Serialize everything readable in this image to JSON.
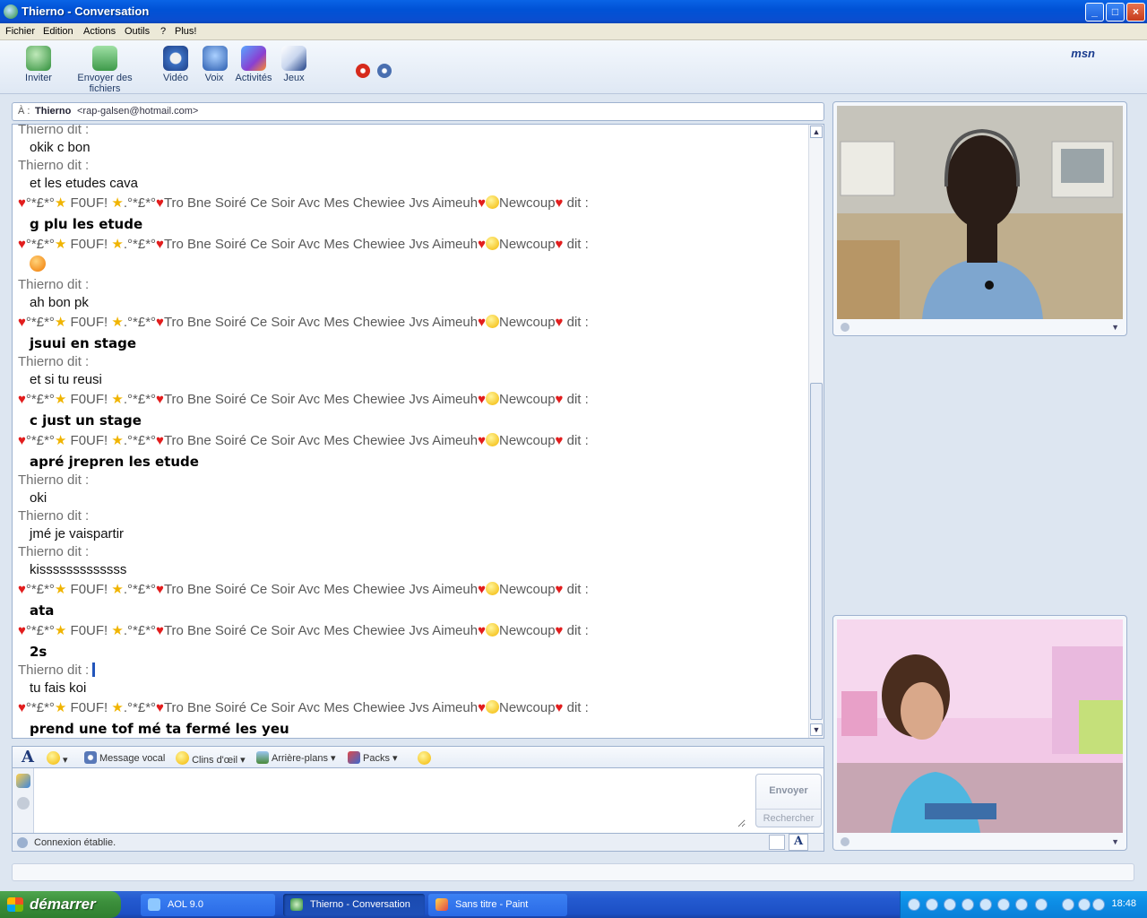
{
  "window": {
    "title": "Thierno - Conversation"
  },
  "menu": [
    "Fichier",
    "Edition",
    "Actions",
    "Outils",
    "?",
    "Plus!"
  ],
  "toolbar": {
    "buttons": [
      "Inviter",
      "Envoyer des fichiers",
      "Vidéo",
      "Voix",
      "Activités",
      "Jeux"
    ],
    "logo": "msn"
  },
  "to": {
    "label": "À :",
    "name": "Thierno",
    "email": "<rap-galsen@hotmail.com>"
  },
  "conversation": {
    "buddy_says": "Thierno dit :",
    "me_fragments": {
      "a": "°*£*°",
      "b": "F0UF!",
      "c": ".°*£*°",
      "d": "Tro Bne Soiré Ce Soir Avc Mes Chewiee Jvs Aimeuh",
      "e": "Newcoup",
      "f": "dit :"
    },
    "lines": {
      "l1": "okik c bon",
      "l2": "et les etudes cava",
      "l3": "g plu les etude",
      "l4": "ah bon pk",
      "l5": "jsuui en stage",
      "l6": "et si tu reusi",
      "l7": "c just un stage",
      "l8": "apré jrepren les etude",
      "l9": "oki",
      "l10": "jmé je vaispartir",
      "l11": "kisssssssssssss",
      "l12": "ata",
      "l13": "2s",
      "l14": "tu fais koi",
      "l15": "prend une tof mé ta fermé les yeu"
    }
  },
  "format_bar": {
    "voice": "Message vocal",
    "winks": "Clins d'œil",
    "backgrounds": "Arrière-plans",
    "packs": "Packs"
  },
  "input": {
    "value": "",
    "send": "Envoyer",
    "search": "Rechercher"
  },
  "status": {
    "text": "Connexion établie."
  },
  "taskbar": {
    "start": "démarrer",
    "tasks": [
      "AOL 9.0",
      "Thierno - Conversation",
      "Sans titre - Paint"
    ],
    "clock": "18:48"
  }
}
